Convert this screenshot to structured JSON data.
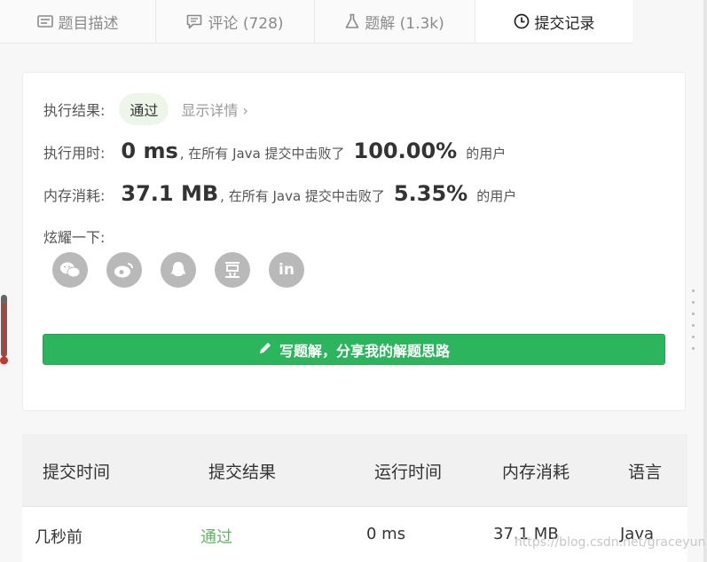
{
  "tabs": [
    {
      "label": "题目描述",
      "icon": "description-icon"
    },
    {
      "label": "评论 (728)",
      "icon": "comment-icon"
    },
    {
      "label": "题解 (1.3k)",
      "icon": "flask-icon"
    },
    {
      "label": "提交记录",
      "icon": "clock-icon"
    }
  ],
  "result": {
    "status_label": "执行结果:",
    "status_value": "通过",
    "detail_link": "显示详情",
    "runtime_label": "执行用时:",
    "runtime_value": "0 ms",
    "runtime_mid": ", 在所有 Java 提交中击败了",
    "runtime_percent": "100.00%",
    "runtime_suffix": "的用户",
    "memory_label": "内存消耗:",
    "memory_value": "37.1 MB",
    "memory_mid": ", 在所有 Java 提交中击败了",
    "memory_percent": "5.35%",
    "memory_suffix": "的用户",
    "share_label": "炫耀一下:",
    "share_icons": [
      "wechat-icon",
      "weibo-icon",
      "qq-icon",
      "douban-icon",
      "linkedin-icon"
    ],
    "write_button": "写题解，分享我的解题思路"
  },
  "table": {
    "headers": [
      "提交时间",
      "提交结果",
      "运行时间",
      "内存消耗",
      "语言"
    ],
    "rows": [
      [
        "几秒前",
        "通过",
        "0 ms",
        "37.1 MB",
        "Java"
      ]
    ]
  },
  "watermark": "https://blog.csdn.net/graceyun",
  "colors": {
    "accent_green": "#2db55d",
    "pass_text": "#5cb85c",
    "badge_bg": "#eef6ea"
  }
}
